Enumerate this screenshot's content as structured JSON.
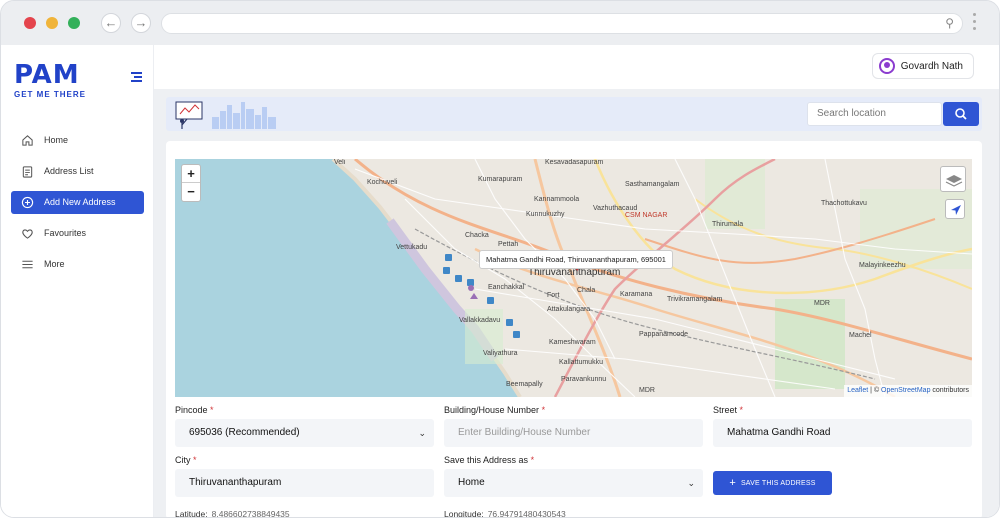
{
  "app": {
    "logo": "PAM",
    "tagline": "GET ME THERE",
    "user_name": "Govardh Nath"
  },
  "sidebar": {
    "items": [
      {
        "label": "Home",
        "icon": "home-icon"
      },
      {
        "label": "Address List",
        "icon": "clipboard-icon"
      },
      {
        "label": "Add New Address",
        "icon": "plus-circle-icon",
        "active": true
      },
      {
        "label": "Favourites",
        "icon": "heart-icon"
      },
      {
        "label": "More",
        "icon": "menu-icon"
      }
    ]
  },
  "search": {
    "placeholder": "Search location"
  },
  "map": {
    "popup": "Mahatma Gandhi Road, Thiruvananthapuram, 695001",
    "attribution_leaflet": "Leaflet",
    "attribution_sep": " | © ",
    "attribution_osm": "OpenStreetMap",
    "attribution_tail": " contributors",
    "zoom_in": "+",
    "zoom_out": "−",
    "labels": {
      "veli": "Veli",
      "kochuveli": "Kochuveli",
      "kumarapuram": "Kumarapuram",
      "sasthamangalam": "Sasthamangalam",
      "kesavadasapuram": "Kesavadasapuram",
      "kannammoola": "Kannammoola",
      "kunnukuzhy": "Kunnukuzhy",
      "vazhuthacaud": "Vazhuthacaud",
      "csm_nagar": "CSM NAGAR",
      "thirumala": "Thirumala",
      "thachottukavu": "Thachottukavu",
      "vettukadu": "Vettukadu",
      "chacka": "Chacka",
      "pettah": "Pettah",
      "thiruvananthapuram": "Thiruvananthapuram",
      "fort": "Fort",
      "chala": "Chala",
      "eanchakkal": "Eanchakkal",
      "karamana": "Karamana",
      "trivikramangalam": "Trivikramangalam",
      "malayinkeezhu": "Malayinkeezhu",
      "vallakkadavu": "Vallakkadavu",
      "attakulangara": "Attakulangara",
      "pappanamcode": "Pappanamcode",
      "kameswaram": "Kameshwaram",
      "valiyathura": "Valiyathura",
      "kallattumukku": "Kallattumukku",
      "beemapally": "Beemapally",
      "paravankunnu": "Paravankunnu",
      "mdr1": "MDR",
      "mdr2": "MDR",
      "machel": "Machel"
    }
  },
  "form": {
    "pincode": {
      "label": "Pincode",
      "value": "695036 (Recommended)"
    },
    "building": {
      "label": "Building/House Number",
      "placeholder": "Enter Building/House Number"
    },
    "street": {
      "label": "Street",
      "value": "Mahatma Gandhi Road"
    },
    "city": {
      "label": "City",
      "value": "Thiruvananthapuram"
    },
    "save_as": {
      "label": "Save this Address as",
      "value": "Home"
    },
    "save_button": "SAVE THIS ADDRESS",
    "latitude": {
      "label": "Latitude:",
      "value": "8.486602738849435"
    },
    "longitude": {
      "label": "Longitude:",
      "value": "76.94791480430543"
    }
  },
  "colors": {
    "brand": "#2142c8",
    "primary": "#2f55d4",
    "required": "#d13438",
    "sea": "#aad3df"
  }
}
